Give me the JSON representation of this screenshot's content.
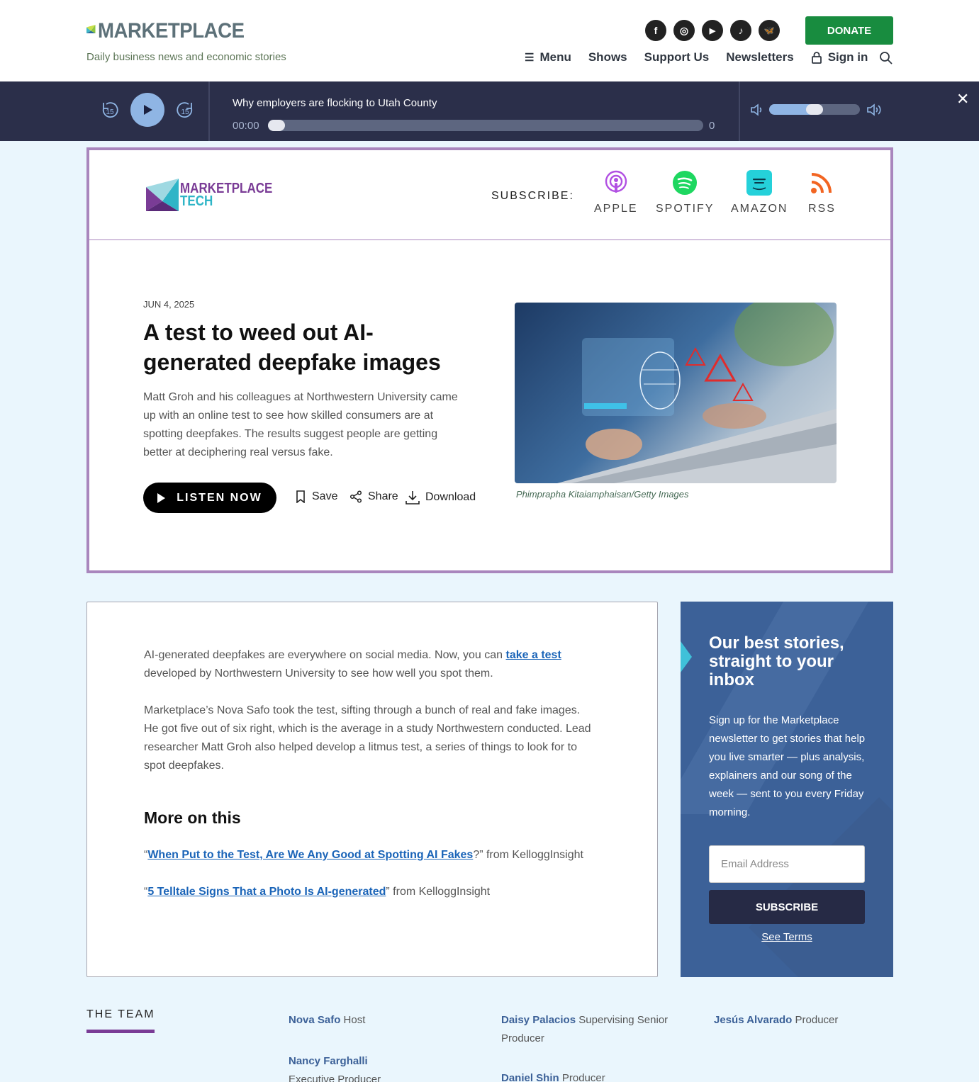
{
  "header": {
    "logo_text": "MARKETPLACE",
    "tagline": "Daily business news and economic stories",
    "socials": [
      {
        "icon": "facebook-icon",
        "glyph": "f"
      },
      {
        "icon": "instagram-icon",
        "glyph": "◎"
      },
      {
        "icon": "youtube-icon",
        "glyph": "▶"
      },
      {
        "icon": "tiktok-icon",
        "glyph": "♪"
      },
      {
        "icon": "bluesky-icon",
        "glyph": "🦋"
      }
    ],
    "donate_label": "DONATE",
    "nav": {
      "menu": "Menu",
      "shows": "Shows",
      "support": "Support Us",
      "newsletters": "Newsletters",
      "signin": "Sign in"
    }
  },
  "player": {
    "skip_back": "15",
    "skip_fwd": "15",
    "title": "Why employers are flocking to Utah County",
    "current_time": "00:00",
    "duration": "0",
    "progress": 0,
    "volume": 0.5
  },
  "episode": {
    "show_name_line1": "MARKETPLACE",
    "show_name_line2": "TECH",
    "subscribe_label": "SUBSCRIBE:",
    "subscribe_options": [
      "APPLE",
      "SPOTIFY",
      "AMAZON",
      "RSS"
    ],
    "date": "JUN 4, 2025",
    "title": "A test to weed out AI-generated deepfake images",
    "description": "Matt Groh and his colleagues at Northwestern University came up with an online test to see how skilled consumers are at spotting deepfakes. The results suggest people are getting better at deciphering real versus fake.",
    "listen_label": "LISTEN NOW",
    "save_label": "Save",
    "share_label": "Share",
    "download_label": "Download",
    "image_credit": "Phimprapha Kitaiamphaisan/Getty Images"
  },
  "article": {
    "p1_pre": "AI-generated deepfakes are everywhere on social media. Now, you can ",
    "p1_link": "take a test",
    "p1_post": " developed by Northwestern University to see how well you spot them.",
    "p2": "Marketplace’s Nova Safo took the test, sifting through a bunch of real and fake images. He got five out of six right, which is the average in a study Northwestern conducted. Lead researcher Matt Groh also helped develop a litmus test, a series of things to look for to spot deepfakes.",
    "more_title": "More on this",
    "more": [
      {
        "open": "“",
        "link": "When Put to the Test, Are We Any Good at Spotting AI Fakes",
        "close": "?” from KelloggInsight"
      },
      {
        "open": "“",
        "link": "5 Telltale Signs That a Photo Is AI-generated",
        "close": "” from KelloggInsight"
      }
    ]
  },
  "newsletter": {
    "title": "Our best stories, straight to your inbox",
    "body": "Sign up for the Marketplace newsletter to get stories that help you live smarter — plus analysis, explainers and our song of the week — sent to you every Friday morning.",
    "email_placeholder": "Email Address",
    "subscribe_label": "SUBSCRIBE",
    "terms_label": "See Terms"
  },
  "team": {
    "heading": "THE TEAM",
    "members": [
      {
        "name": "Nova Safo",
        "role": "Host"
      },
      {
        "name": "Daisy Palacios",
        "role": "Supervising Senior Producer"
      },
      {
        "name": "Jesús Alvarado",
        "role": "Producer"
      },
      {
        "name": "Nancy Farghalli",
        "role": "Executive Producer"
      },
      {
        "name": "Daniel Shin",
        "role": "Producer"
      }
    ]
  }
}
